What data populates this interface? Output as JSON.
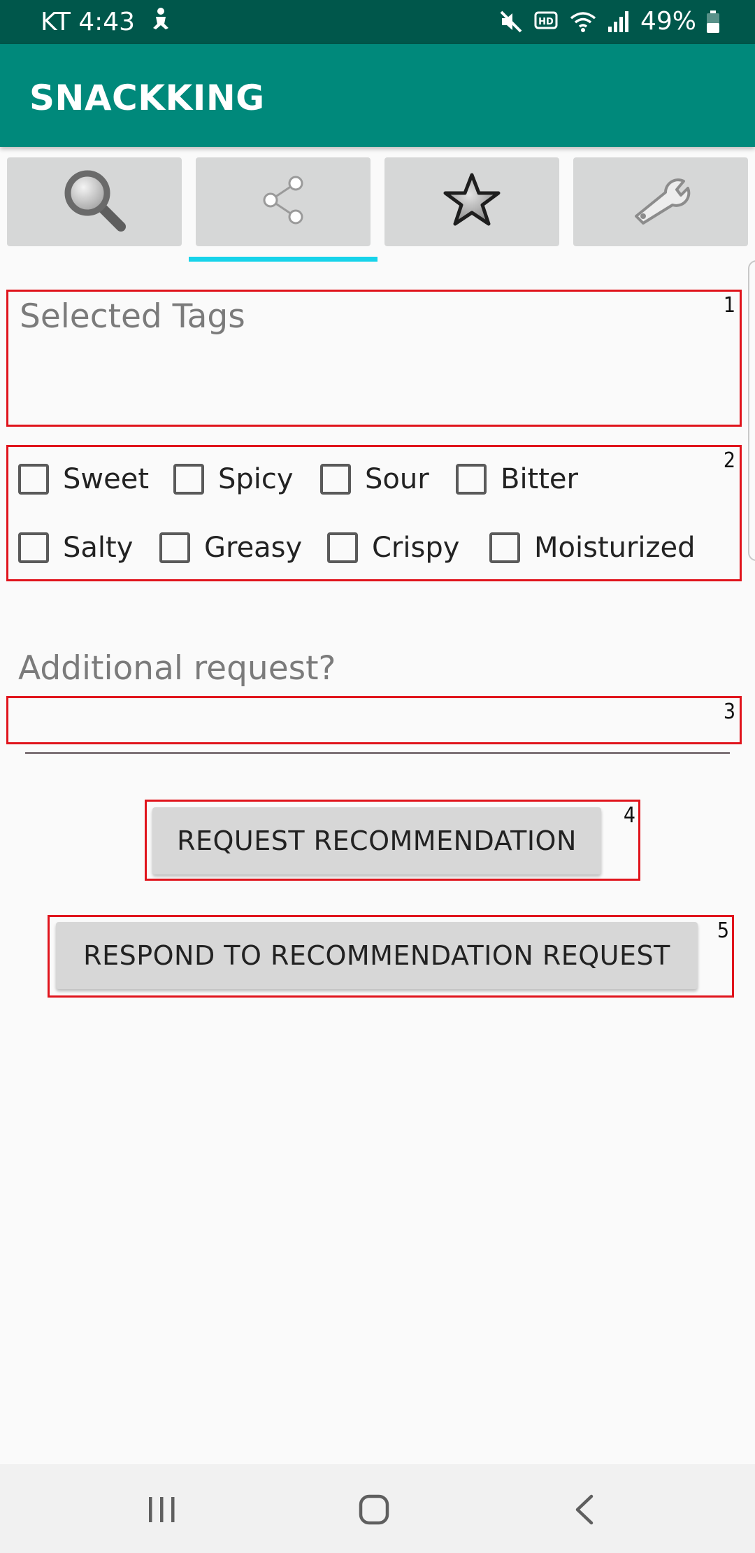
{
  "status_bar": {
    "carrier_time": "KT 4:43",
    "battery": "49%",
    "icons": [
      "notification-person-icon",
      "mute-icon",
      "hd-voice-icon",
      "wifi-icon",
      "signal-icon",
      "battery-icon"
    ]
  },
  "app_bar": {
    "title": "SNACKKING"
  },
  "tabs": [
    {
      "icon": "search-icon",
      "selected": false
    },
    {
      "icon": "share-icon",
      "selected": true
    },
    {
      "icon": "star-icon",
      "selected": false
    },
    {
      "icon": "wrench-icon",
      "selected": false
    }
  ],
  "selected_tags": {
    "hint": "Selected Tags",
    "box_number": "1"
  },
  "tag_checkboxes": {
    "box_number": "2",
    "items": [
      "Sweet",
      "Spicy",
      "Sour",
      "Bitter",
      "Salty",
      "Greasy",
      "Crispy",
      "Moisturized"
    ]
  },
  "additional_request": {
    "label": "Additional request?",
    "value": "",
    "box_number": "3"
  },
  "buttons": {
    "request": {
      "label": "REQUEST RECOMMENDATION",
      "box_number": "4"
    },
    "respond": {
      "label": "RESPOND TO RECOMMENDATION REQUEST",
      "box_number": "5"
    }
  },
  "colors": {
    "status_bar": "#00574b",
    "app_bar": "#00897b",
    "tab_indicator": "#17d3ea",
    "annotation_red": "#e0141c"
  },
  "nav_bar": {
    "icons": [
      "recent-apps-icon",
      "home-icon",
      "back-icon"
    ]
  }
}
